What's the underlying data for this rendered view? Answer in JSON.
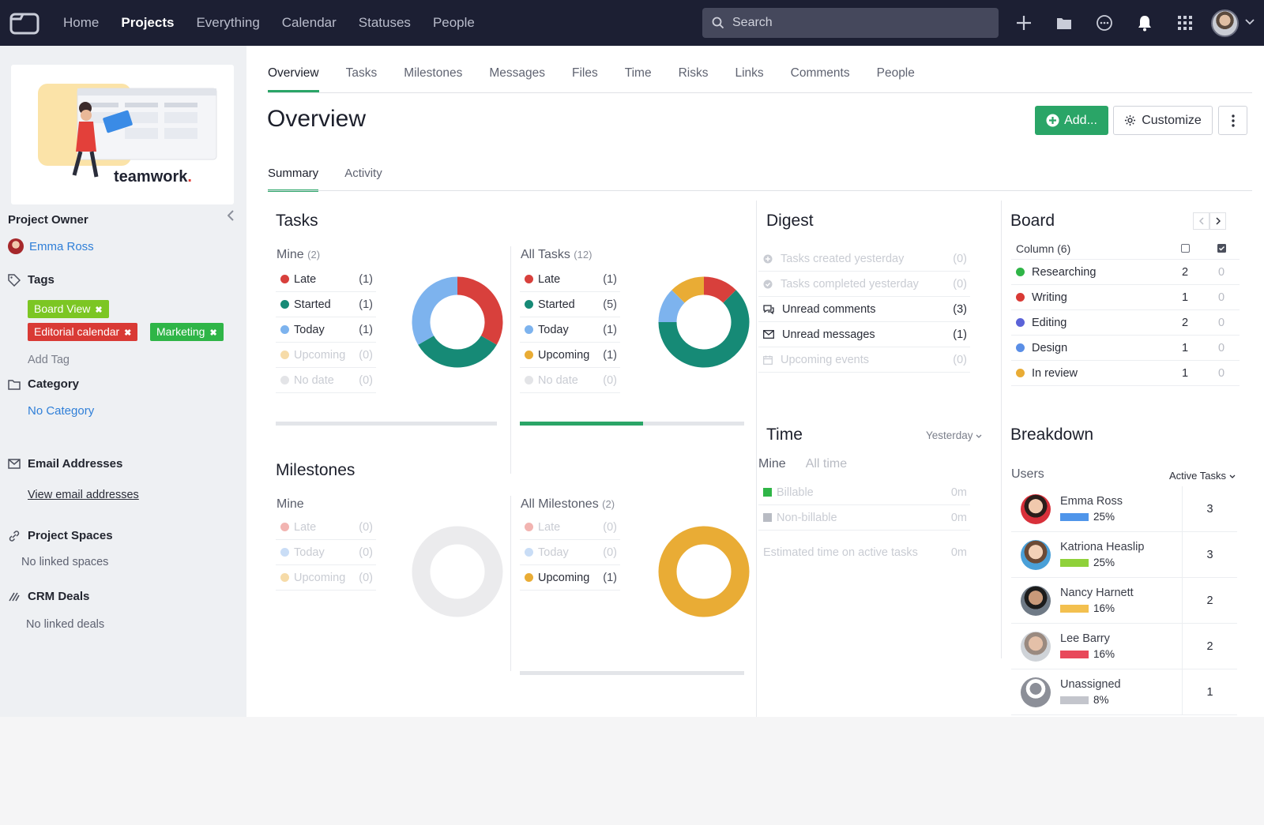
{
  "nav": {
    "links": [
      {
        "label": "Home",
        "active": false
      },
      {
        "label": "Projects",
        "active": true
      },
      {
        "label": "Everything",
        "active": false
      },
      {
        "label": "Calendar",
        "active": false
      },
      {
        "label": "Statuses",
        "active": false
      },
      {
        "label": "People",
        "active": false
      }
    ],
    "search_placeholder": "Search",
    "icons": [
      "plus-icon",
      "folder-icon",
      "chat-icon",
      "bell-icon",
      "apps-grid-icon"
    ]
  },
  "sidebar": {
    "logo_text": "teamwork",
    "owner_label": "Project Owner",
    "owner_name": "Emma Ross",
    "tags_label": "Tags",
    "tags": [
      {
        "label": "Board View",
        "color": "#7cc623"
      },
      {
        "label": "Editorial calendar",
        "color": "#d93a35"
      },
      {
        "label": "Marketing",
        "color": "#2fb547"
      }
    ],
    "add_tag": "Add Tag",
    "category_label": "Category",
    "category_value": "No Category",
    "email_label": "Email Addresses",
    "email_link": "View email addresses",
    "spaces_label": "Project Spaces",
    "spaces_value": "No linked spaces",
    "crm_label": "CRM Deals",
    "crm_value": "No linked deals"
  },
  "tabs": [
    "Overview",
    "Tasks",
    "Milestones",
    "Messages",
    "Files",
    "Time",
    "Risks",
    "Links",
    "Comments",
    "People"
  ],
  "page_title": "Overview",
  "buttons": {
    "add": "Add...",
    "customize": "Customize"
  },
  "subtabs": [
    "Summary",
    "Activity"
  ],
  "tasks": {
    "title": "Tasks",
    "mine": {
      "label": "Mine",
      "count": "(2)",
      "rows": [
        {
          "label": "Late",
          "n": "(1)",
          "color": "#d8403c",
          "dim": false
        },
        {
          "label": "Started",
          "n": "(1)",
          "color": "#168a76",
          "dim": false
        },
        {
          "label": "Today",
          "n": "(1)",
          "color": "#7db3ee",
          "dim": false
        },
        {
          "label": "Upcoming",
          "n": "(0)",
          "color": "#f6dba8",
          "dim": true
        },
        {
          "label": "No date",
          "n": "(0)",
          "color": "#e3e4e7",
          "dim": true
        }
      ],
      "progress": 0
    },
    "all": {
      "label": "All Tasks",
      "count": "(12)",
      "rows": [
        {
          "label": "Late",
          "n": "(1)",
          "color": "#d8403c",
          "dim": false
        },
        {
          "label": "Started",
          "n": "(5)",
          "color": "#168a76",
          "dim": false
        },
        {
          "label": "Today",
          "n": "(1)",
          "color": "#7db3ee",
          "dim": false
        },
        {
          "label": "Upcoming",
          "n": "(1)",
          "color": "#e9ac35",
          "dim": false
        },
        {
          "label": "No date",
          "n": "(0)",
          "color": "#e3e4e7",
          "dim": true
        }
      ],
      "progress": 0.55
    }
  },
  "milestones": {
    "title": "Milestones",
    "mine": {
      "label": "Mine",
      "count": "",
      "rows": [
        {
          "label": "Late",
          "n": "(0)",
          "color": "#f2b4b1",
          "dim": true
        },
        {
          "label": "Today",
          "n": "(0)",
          "color": "#c9ddf6",
          "dim": true
        },
        {
          "label": "Upcoming",
          "n": "(0)",
          "color": "#f6dba8",
          "dim": true
        }
      ]
    },
    "all": {
      "label": "All Milestones",
      "count": "(2)",
      "rows": [
        {
          "label": "Late",
          "n": "(0)",
          "color": "#f2b4b1",
          "dim": true
        },
        {
          "label": "Today",
          "n": "(0)",
          "color": "#c9ddf6",
          "dim": true
        },
        {
          "label": "Upcoming",
          "n": "(1)",
          "color": "#e9ac35",
          "dim": false
        }
      ],
      "progress": 0
    }
  },
  "digest": {
    "title": "Digest",
    "rows": [
      {
        "label": "Tasks created yesterday",
        "n": "(0)",
        "icon": "plus-circle-icon",
        "dim": true
      },
      {
        "label": "Tasks completed yesterday",
        "n": "(0)",
        "icon": "check-circle-icon",
        "dim": true
      },
      {
        "label": "Unread comments",
        "n": "(3)",
        "icon": "comments-icon",
        "dim": false
      },
      {
        "label": "Unread messages",
        "n": "(1)",
        "icon": "envelope-icon",
        "dim": false
      },
      {
        "label": "Upcoming events",
        "n": "(0)",
        "icon": "calendar-icon",
        "dim": true
      }
    ]
  },
  "time": {
    "title": "Time",
    "period": "Yesterday",
    "toggle": [
      "Mine",
      "All time"
    ],
    "rows": [
      {
        "label": "Billable",
        "n": "0m",
        "color": "#2fb547"
      },
      {
        "label": "Non-billable",
        "n": "0m",
        "color": "#b8bbc3"
      }
    ],
    "estimated_label": "Estimated time on active tasks",
    "estimated_value": "0m"
  },
  "board": {
    "title": "Board",
    "column_header": "Column (6)",
    "rows": [
      {
        "label": "Researching",
        "a": "2",
        "b": "0",
        "color": "#2fb547"
      },
      {
        "label": "Writing",
        "a": "1",
        "b": "0",
        "color": "#d93a35"
      },
      {
        "label": "Editing",
        "a": "2",
        "b": "0",
        "color": "#5b63d8"
      },
      {
        "label": "Design",
        "a": "1",
        "b": "0",
        "color": "#5a8ee6"
      },
      {
        "label": "In review",
        "a": "1",
        "b": "0",
        "color": "#e9ac35"
      }
    ]
  },
  "breakdown": {
    "title": "Breakdown",
    "users_label": "Users",
    "filter": "Active Tasks",
    "users": [
      {
        "name": "Emma Ross",
        "pct": "25%",
        "count": "3",
        "bar": "#4f95ea"
      },
      {
        "name": "Katriona Heaslip",
        "pct": "25%",
        "count": "3",
        "bar": "#8fd13a"
      },
      {
        "name": "Nancy Harnett",
        "pct": "16%",
        "count": "2",
        "bar": "#f3c04f"
      },
      {
        "name": "Lee Barry",
        "pct": "16%",
        "count": "2",
        "bar": "#e8485a"
      },
      {
        "name": "Unassigned",
        "pct": "8%",
        "count": "1",
        "bar": "#c3c5cc"
      }
    ]
  },
  "charts": {
    "colors": {
      "late": "#d8403c",
      "started": "#168a76",
      "today": "#7db3ee",
      "upcoming": "#e9ac35",
      "empty": "#ebebed"
    }
  }
}
